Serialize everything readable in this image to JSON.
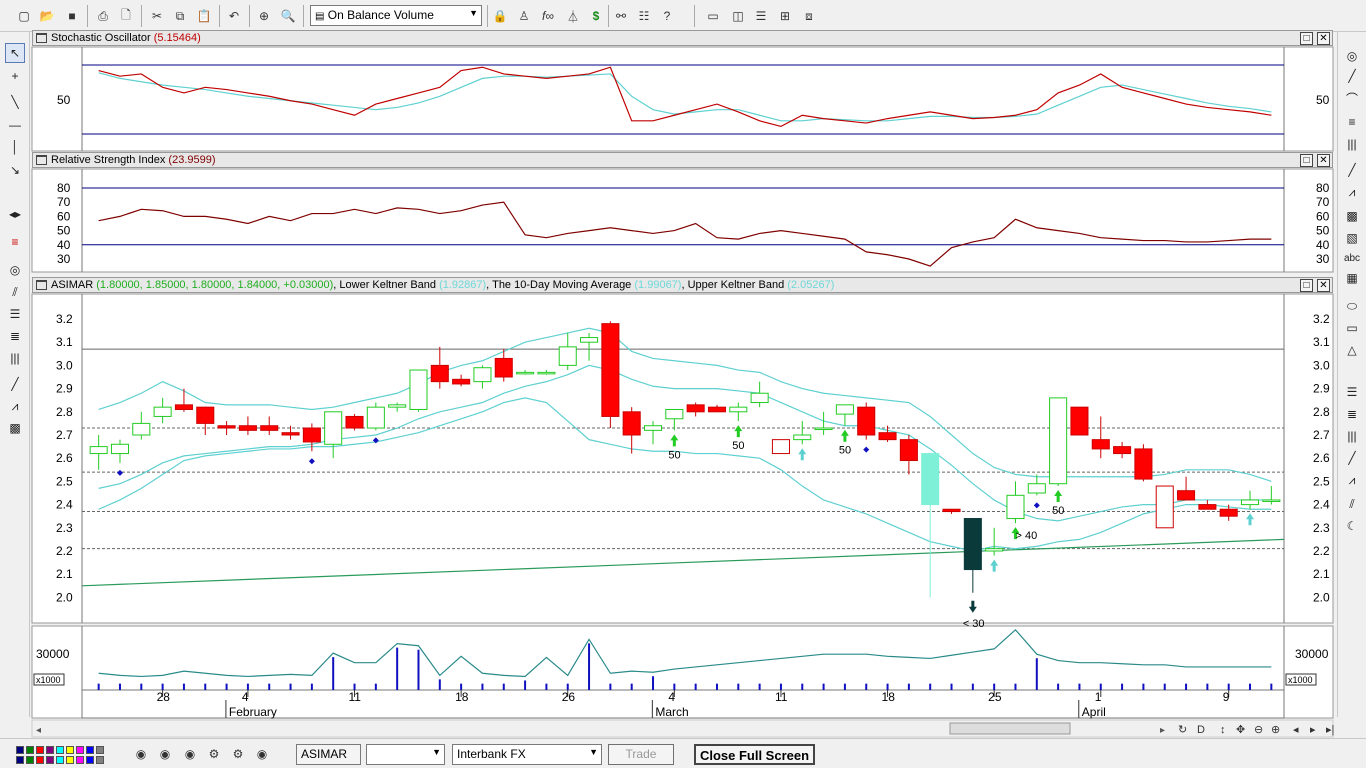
{
  "toolbar": {
    "indicator_select": "On Balance Volume",
    "icons": [
      "new-icon",
      "open-icon",
      "save-icon",
      "print-icon",
      "print-preview-icon",
      "cut-icon",
      "copy-icon",
      "paste-icon",
      "undo-icon",
      "crosshair-icon",
      "zoom-icon",
      "lock-icon",
      "wizard-icon",
      "function-icon",
      "triangle-icon",
      "dollar-icon",
      "binoculars-icon",
      "list-icon",
      "help-icon",
      "window-icon",
      "tile-vertical-icon",
      "tile-horizontal-icon",
      "grid-icon",
      "screenshot-icon"
    ]
  },
  "panes": {
    "stochastic": {
      "title": "Stochastic Oscillator",
      "value": "(5.15464)"
    },
    "rsi": {
      "title": "Relative Strength Index",
      "value": "(23.9599)"
    },
    "price": {
      "symbol": "ASIMAR",
      "ohlc": "(1.80000, 1.85000, 1.80000, 1.84000, +0.03000)",
      "lower_label": "Lower Keltner Band",
      "lower_value": "(1.92867)",
      "ma_label": "The 10-Day Moving Average",
      "ma_value": "(1.99067)",
      "upper_label": "Upper Keltner Band",
      "upper_value": "(2.05267)"
    }
  },
  "chart_data": {
    "type": "candlestick",
    "price_axis": [
      "3.2",
      "3.1",
      "3.0",
      "2.9",
      "2.8",
      "2.7",
      "2.6",
      "2.5",
      "2.4",
      "2.3",
      "2.2",
      "2.1",
      "2.0"
    ],
    "stoch_axis": [
      "50"
    ],
    "rsi_axis": [
      "80",
      "70",
      "60",
      "50",
      "40",
      "30"
    ],
    "volume_axis": [
      "30000",
      "x1000"
    ],
    "date_ticks": [
      "28",
      "4",
      "11",
      "18",
      "26",
      "4",
      "11",
      "18",
      "25",
      "1",
      "9"
    ],
    "month_labels": [
      "February",
      "March",
      "April"
    ],
    "candles": [
      {
        "o": 2.62,
        "h": 2.7,
        "l": 2.55,
        "c": 2.65
      },
      {
        "o": 2.62,
        "h": 2.68,
        "l": 2.58,
        "c": 2.66
      },
      {
        "o": 2.7,
        "h": 2.8,
        "l": 2.68,
        "c": 2.75
      },
      {
        "o": 2.78,
        "h": 2.86,
        "l": 2.75,
        "c": 2.82
      },
      {
        "o": 2.83,
        "h": 2.9,
        "l": 2.8,
        "c": 2.81
      },
      {
        "o": 2.82,
        "h": 2.82,
        "l": 2.7,
        "c": 2.75
      },
      {
        "o": 2.74,
        "h": 2.76,
        "l": 2.7,
        "c": 2.73
      },
      {
        "o": 2.74,
        "h": 2.78,
        "l": 2.7,
        "c": 2.72
      },
      {
        "o": 2.74,
        "h": 2.78,
        "l": 2.7,
        "c": 2.72
      },
      {
        "o": 2.71,
        "h": 2.74,
        "l": 2.68,
        "c": 2.7
      },
      {
        "o": 2.73,
        "h": 2.75,
        "l": 2.63,
        "c": 2.67
      },
      {
        "o": 2.66,
        "h": 2.8,
        "l": 2.6,
        "c": 2.8
      },
      {
        "o": 2.78,
        "h": 2.79,
        "l": 2.72,
        "c": 2.73
      },
      {
        "o": 2.73,
        "h": 2.84,
        "l": 2.72,
        "c": 2.82
      },
      {
        "o": 2.82,
        "h": 2.84,
        "l": 2.8,
        "c": 2.83
      },
      {
        "o": 2.81,
        "h": 2.98,
        "l": 2.8,
        "c": 2.98
      },
      {
        "o": 3.0,
        "h": 3.08,
        "l": 2.9,
        "c": 2.93
      },
      {
        "o": 2.94,
        "h": 2.96,
        "l": 2.91,
        "c": 2.92
      },
      {
        "o": 2.93,
        "h": 3.0,
        "l": 2.9,
        "c": 2.99
      },
      {
        "o": 3.03,
        "h": 3.07,
        "l": 2.93,
        "c": 2.95
      },
      {
        "o": 2.97,
        "h": 2.98,
        "l": 2.96,
        "c": 2.97
      },
      {
        "o": 2.97,
        "h": 2.98,
        "l": 2.96,
        "c": 2.97
      },
      {
        "o": 3.0,
        "h": 3.14,
        "l": 2.98,
        "c": 3.08
      },
      {
        "o": 3.1,
        "h": 3.14,
        "l": 3.02,
        "c": 3.12
      },
      {
        "o": 3.18,
        "h": 3.19,
        "l": 2.73,
        "c": 2.78
      },
      {
        "o": 2.8,
        "h": 2.82,
        "l": 2.62,
        "c": 2.7
      },
      {
        "o": 2.72,
        "h": 2.76,
        "l": 2.66,
        "c": 2.74
      },
      {
        "o": 2.77,
        "h": 2.8,
        "l": 2.72,
        "c": 2.81
      },
      {
        "o": 2.83,
        "h": 2.84,
        "l": 2.78,
        "c": 2.8
      },
      {
        "o": 2.82,
        "h": 2.83,
        "l": 2.8,
        "c": 2.8
      },
      {
        "o": 2.8,
        "h": 2.84,
        "l": 2.76,
        "c": 2.82
      },
      {
        "o": 2.84,
        "h": 2.93,
        "l": 2.82,
        "c": 2.88
      },
      {
        "o": 2.68,
        "h": 2.68,
        "l": 2.62,
        "c": 2.62
      },
      {
        "o": 2.68,
        "h": 2.76,
        "l": 2.66,
        "c": 2.7
      },
      {
        "o": 2.73,
        "h": 2.8,
        "l": 2.7,
        "c": 2.73
      },
      {
        "o": 2.79,
        "h": 2.83,
        "l": 2.74,
        "c": 2.83
      },
      {
        "o": 2.82,
        "h": 2.84,
        "l": 2.68,
        "c": 2.7
      },
      {
        "o": 2.71,
        "h": 2.74,
        "l": 2.67,
        "c": 2.68
      },
      {
        "o": 2.68,
        "h": 2.7,
        "l": 2.53,
        "c": 2.59
      },
      {
        "o": 2.4,
        "h": 2.62,
        "l": 2.0,
        "c": 2.62
      },
      {
        "o": 2.38,
        "h": 2.38,
        "l": 2.36,
        "c": 2.37
      },
      {
        "o": 2.34,
        "h": 2.34,
        "l": 2.02,
        "c": 2.12
      },
      {
        "o": 2.2,
        "h": 2.3,
        "l": 2.18,
        "c": 2.21
      },
      {
        "o": 2.34,
        "h": 2.5,
        "l": 2.32,
        "c": 2.44
      },
      {
        "o": 2.45,
        "h": 2.53,
        "l": 2.44,
        "c": 2.49
      },
      {
        "o": 2.49,
        "h": 2.86,
        "l": 2.48,
        "c": 2.86
      },
      {
        "o": 2.82,
        "h": 2.82,
        "l": 2.7,
        "c": 2.7
      },
      {
        "o": 2.68,
        "h": 2.78,
        "l": 2.6,
        "c": 2.64
      },
      {
        "o": 2.65,
        "h": 2.67,
        "l": 2.6,
        "c": 2.62
      },
      {
        "o": 2.64,
        "h": 2.66,
        "l": 2.5,
        "c": 2.51
      },
      {
        "o": 2.48,
        "h": 2.48,
        "l": 2.3,
        "c": 2.3
      },
      {
        "o": 2.46,
        "h": 2.52,
        "l": 2.42,
        "c": 2.42
      },
      {
        "o": 2.4,
        "h": 2.42,
        "l": 2.38,
        "c": 2.38
      },
      {
        "o": 2.38,
        "h": 2.4,
        "l": 2.33,
        "c": 2.35
      },
      {
        "o": 2.4,
        "h": 2.46,
        "l": 2.38,
        "c": 2.42
      },
      {
        "o": 2.42,
        "h": 2.48,
        "l": 2.4,
        "c": 2.42
      }
    ],
    "stoch_k": [
      75,
      70,
      72,
      60,
      55,
      60,
      58,
      55,
      52,
      48,
      45,
      40,
      35,
      45,
      50,
      55,
      60,
      75,
      78,
      72,
      70,
      68,
      70,
      72,
      78,
      30,
      30,
      35,
      40,
      45,
      38,
      30,
      25,
      35,
      32,
      30,
      28,
      32,
      35,
      38,
      35,
      32,
      33,
      35,
      40,
      55,
      62,
      72,
      60,
      55,
      50,
      45,
      42,
      40,
      38,
      35
    ],
    "stoch_d": [
      73,
      68,
      65,
      62,
      60,
      58,
      55,
      52,
      50,
      48,
      46,
      44,
      42,
      40,
      42,
      46,
      52,
      60,
      68,
      70,
      70,
      69,
      70,
      71,
      72,
      52,
      40,
      36,
      38,
      40,
      40,
      35,
      30,
      30,
      32,
      31,
      30,
      30,
      32,
      34,
      34,
      33,
      33,
      34,
      36,
      44,
      52,
      60,
      62,
      58,
      54,
      50,
      46,
      43,
      41,
      38
    ],
    "rsi": [
      57,
      60,
      65,
      64,
      60,
      60,
      58,
      55,
      60,
      57,
      62,
      62,
      65,
      62,
      66,
      65,
      62,
      64,
      68,
      70,
      47,
      45,
      48,
      50,
      52,
      50,
      48,
      50,
      55,
      45,
      44,
      48,
      50,
      48,
      46,
      44,
      35,
      33,
      30,
      25,
      38,
      42,
      45,
      58,
      52,
      50,
      48,
      45,
      44,
      43,
      43,
      42,
      42,
      43,
      44,
      44
    ],
    "volume": [
      12,
      10,
      9,
      10,
      14,
      12,
      10,
      9,
      10,
      11,
      10,
      31,
      22,
      22,
      40,
      38,
      10,
      28,
      12,
      10,
      9,
      27,
      10,
      44,
      12,
      14,
      13,
      16,
      18,
      20,
      22,
      24,
      26,
      28,
      30,
      30,
      30,
      28,
      27,
      26,
      29,
      32,
      35,
      53,
      30,
      24,
      22,
      22,
      21,
      20,
      20,
      18,
      18,
      18,
      18,
      18
    ],
    "volume_spikes": [
      11,
      14,
      15,
      16,
      20,
      23,
      26,
      44
    ],
    "ma10": [
      2.47,
      2.49,
      2.53,
      2.58,
      2.61,
      2.62,
      2.63,
      2.64,
      2.65,
      2.65,
      2.66,
      2.68,
      2.69,
      2.7,
      2.73,
      2.77,
      2.8,
      2.82,
      2.84,
      2.88,
      2.91,
      2.93,
      2.96,
      3.0,
      2.98,
      2.94,
      2.91,
      2.9,
      2.9,
      2.9,
      2.89,
      2.88,
      2.84,
      2.8,
      2.76,
      2.74,
      2.74,
      2.72,
      2.7,
      2.64,
      2.57,
      2.49,
      2.42,
      2.37,
      2.34,
      2.33,
      2.35,
      2.37,
      2.39,
      2.4,
      2.4,
      2.42,
      2.42,
      2.42,
      2.42,
      2.42
    ],
    "upper_band": [
      2.81,
      2.84,
      2.88,
      2.93,
      2.89,
      2.84,
      2.83,
      2.83,
      2.83,
      2.82,
      2.81,
      2.82,
      2.84,
      2.86,
      2.88,
      2.92,
      2.97,
      3.0,
      3.02,
      3.06,
      3.1,
      3.12,
      3.14,
      3.16,
      3.14,
      3.06,
      3.03,
      3.02,
      3.01,
      3.0,
      2.98,
      2.97,
      2.93,
      2.9,
      2.88,
      2.87,
      2.86,
      2.85,
      2.84,
      2.78,
      2.7,
      2.62,
      2.56,
      2.53,
      2.52,
      2.52,
      2.52,
      2.52,
      2.52,
      2.52,
      2.53,
      2.55,
      2.55,
      2.55,
      2.53,
      2.5
    ],
    "lower_band": [
      2.38,
      2.42,
      2.47,
      2.53,
      2.59,
      2.61,
      2.62,
      2.63,
      2.64,
      2.64,
      2.65,
      2.65,
      2.66,
      2.67,
      2.69,
      2.71,
      2.74,
      2.77,
      2.8,
      2.84,
      2.86,
      2.84,
      2.76,
      2.68,
      2.66,
      2.64,
      2.63,
      2.63,
      2.62,
      2.62,
      2.61,
      2.6,
      2.55,
      2.48,
      2.42,
      2.39,
      2.36,
      2.32,
      2.28,
      2.24,
      2.22,
      2.2,
      2.22,
      2.21,
      2.22,
      2.24,
      2.25,
      2.28,
      2.32,
      2.36,
      2.38,
      2.4,
      2.4,
      2.39,
      2.38,
      2.38
    ],
    "trend_line": [
      2.05,
      2.25
    ],
    "hlines_price": [
      3.07,
      2.73,
      2.54,
      2.37,
      2.21
    ],
    "annotations": [
      "50",
      "50",
      "50",
      "> 40",
      "50",
      "< 30"
    ]
  },
  "statusbar": {
    "symbol": "ASIMAR",
    "feed": "Interbank FX",
    "trade_label": "Trade",
    "close_label": "Close Full Screen",
    "colors": [
      "#000080",
      "#008000",
      "#ff0000",
      "#800080",
      "#00ffff",
      "#ffff00",
      "#ff00ff",
      "#0000ff",
      "#808080"
    ]
  }
}
